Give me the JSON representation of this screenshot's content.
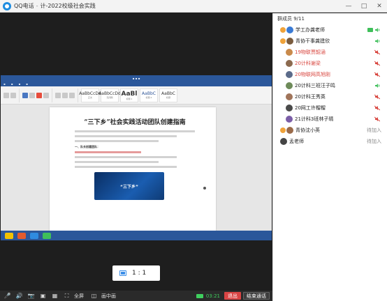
{
  "titlebar": {
    "app_name": "QQ电话",
    "separator": "-",
    "call_name": "计-2022校级社会实践",
    "controls": [
      "—",
      "□",
      "✕"
    ]
  },
  "shared_doc": {
    "title": "“三下乡”社会实践活动团队创建指南",
    "section_heading": "一、队长创建团队：",
    "image_caption": "“三下乡”",
    "ribbon_styles": [
      {
        "sample": "AaBbCcDd",
        "caption": "正文"
      },
      {
        "sample": "AaBbCcDd",
        "caption": "无间隔"
      },
      {
        "sample": "AaBl",
        "caption": "标题 1"
      },
      {
        "sample": "AaBbC",
        "caption": "标题 2"
      },
      {
        "sample": "AaBbC",
        "caption": "标题"
      }
    ]
  },
  "zoom": {
    "label": "1 : 1"
  },
  "toolbar": {
    "fullscreen_label": "全屏",
    "pip_label": "画中画",
    "timer": "03:21",
    "exit_label": "退出",
    "end_label": "结束通话"
  },
  "panel": {
    "title": "群成员 9/11",
    "members": [
      {
        "name": "学工办龚老师",
        "status": "",
        "color": "#3a7bd5",
        "highlight": false
      },
      {
        "name": "青协干事龚建欣",
        "status": "",
        "color": "#7a5c3e",
        "highlight": false
      },
      {
        "name": "19物联贾韶涵",
        "status": "",
        "color": "#c98a4b",
        "highlight": true
      },
      {
        "name": "20计科谢梁",
        "status": "",
        "color": "#8c6a4f",
        "highlight": true
      },
      {
        "name": "20物联网高旭刚",
        "status": "",
        "color": "#5b6b8a",
        "highlight": true
      },
      {
        "name": "20计科三班汪子鸣",
        "status": "",
        "color": "#6e8b5a",
        "highlight": false
      },
      {
        "name": "20计科王秀英",
        "status": "",
        "color": "#a0745a",
        "highlight": false
      },
      {
        "name": "20网工许榴榴",
        "status": "",
        "color": "#4a4a4a",
        "highlight": false
      },
      {
        "name": "21计科3班林子晴",
        "status": "",
        "color": "#7b5ea7",
        "highlight": false
      },
      {
        "name": "青协沈小英",
        "status": "待加入",
        "color": "#9a6b4a",
        "highlight": false
      },
      {
        "name": "孟老师",
        "status": "待加入",
        "color": "#444444",
        "highlight": false
      }
    ]
  }
}
